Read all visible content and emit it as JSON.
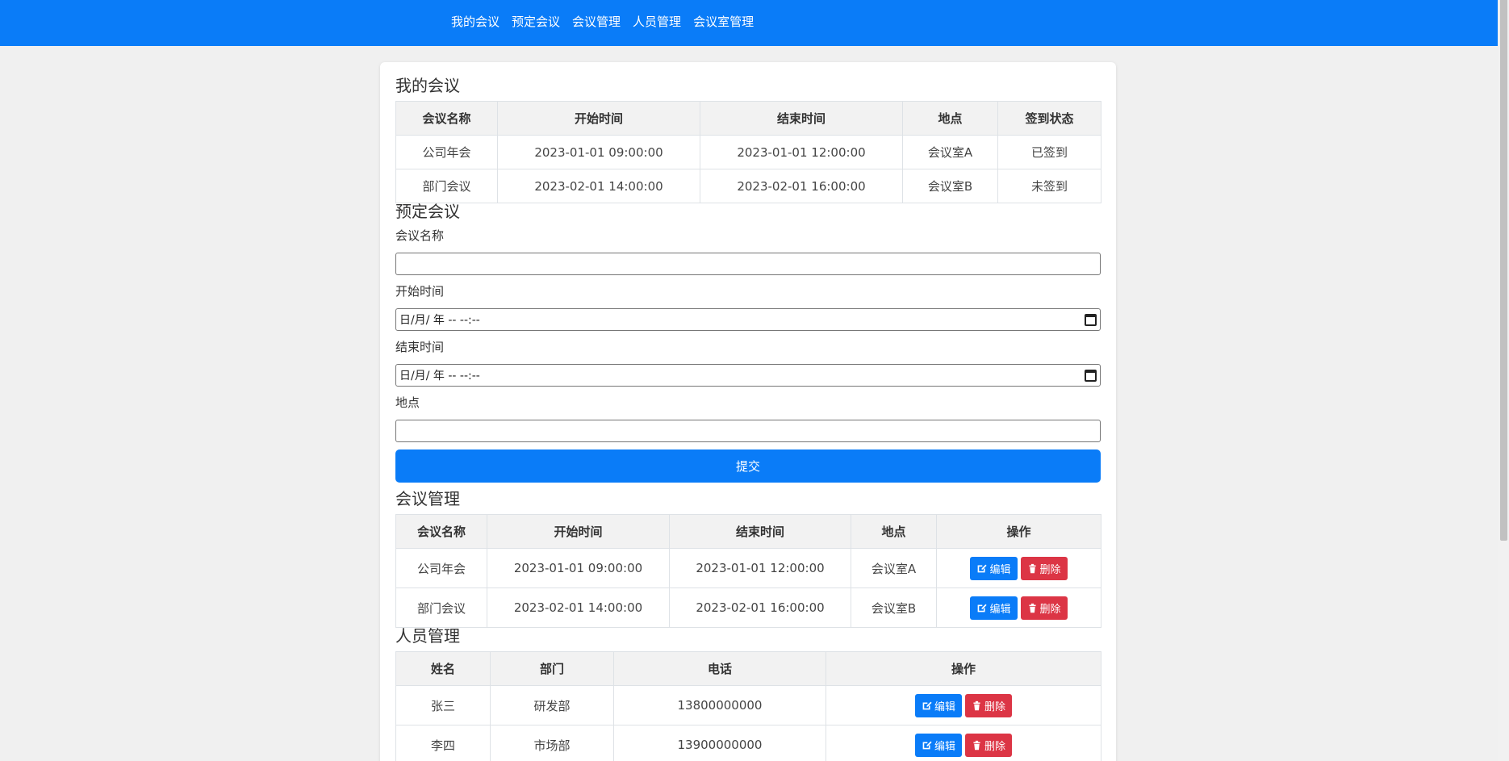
{
  "nav": {
    "items": [
      "我的会议",
      "预定会议",
      "会议管理",
      "人员管理",
      "会议室管理"
    ]
  },
  "my_meetings": {
    "title": "我的会议",
    "headers": [
      "会议名称",
      "开始时间",
      "结束时间",
      "地点",
      "签到状态"
    ],
    "rows": [
      [
        "公司年会",
        "2023-01-01 09:00:00",
        "2023-01-01 12:00:00",
        "会议室A",
        "已签到"
      ],
      [
        "部门会议",
        "2023-02-01 14:00:00",
        "2023-02-01 16:00:00",
        "会议室B",
        "未签到"
      ]
    ]
  },
  "booking": {
    "title": "预定会议",
    "name_label": "会议名称",
    "start_label": "开始时间",
    "start_value": "日/月/ 年  -- --:--",
    "end_label": "结束时间",
    "end_value": "日/月/ 年  -- --:--",
    "location_label": "地点",
    "submit_label": "提交"
  },
  "meeting_mgmt": {
    "title": "会议管理",
    "headers": [
      "会议名称",
      "开始时间",
      "结束时间",
      "地点",
      "操作"
    ],
    "rows": [
      [
        "公司年会",
        "2023-01-01 09:00:00",
        "2023-01-01 12:00:00",
        "会议室A"
      ],
      [
        "部门会议",
        "2023-02-01 14:00:00",
        "2023-02-01 16:00:00",
        "会议室B"
      ]
    ]
  },
  "people_mgmt": {
    "title": "人员管理",
    "headers": [
      "姓名",
      "部门",
      "电话",
      "操作"
    ],
    "rows": [
      [
        "张三",
        "研发部",
        "13800000000"
      ],
      [
        "李四",
        "市场部",
        "13900000000"
      ]
    ]
  },
  "actions": {
    "edit": "编辑",
    "delete": "删除"
  },
  "colors": {
    "primary": "#0a7cf8",
    "danger": "#dc3545"
  }
}
